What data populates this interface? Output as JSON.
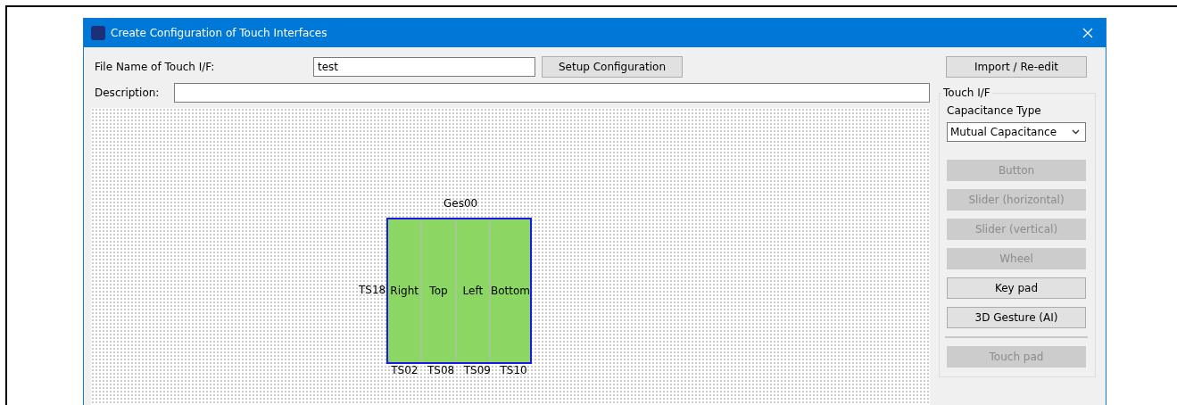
{
  "window": {
    "title": "Create Configuration of Touch Interfaces"
  },
  "file_name": {
    "label": "File Name of Touch I/F:",
    "value": "test"
  },
  "setup_button": "Setup Configuration",
  "import_button": "Import / Re-edit",
  "description": {
    "label": "Description:"
  },
  "canvas": {
    "gesture": {
      "name": "Ges00",
      "left_label": "TS18",
      "segments": [
        {
          "label": "Right",
          "sensor": "TS02"
        },
        {
          "label": "Top",
          "sensor": "TS08"
        },
        {
          "label": "Left",
          "sensor": "TS09"
        },
        {
          "label": "Bottom",
          "sensor": "TS10"
        }
      ]
    }
  },
  "touch_if": {
    "title": "Touch I/F",
    "capacitance_label": "Capacitance Type",
    "capacitance_value": "Mutual Capacitance",
    "buttons": [
      {
        "label": "Button",
        "disabled": true
      },
      {
        "label": "Slider (horizontal)",
        "disabled": true
      },
      {
        "label": "Slider (vertical)",
        "disabled": true
      },
      {
        "label": "Wheel",
        "disabled": true
      },
      {
        "label": "Key pad",
        "disabled": false
      },
      {
        "label": "3D Gesture (AI)",
        "disabled": false
      },
      {
        "kind": "separator"
      },
      {
        "label": "Touch pad",
        "disabled": true
      }
    ]
  }
}
